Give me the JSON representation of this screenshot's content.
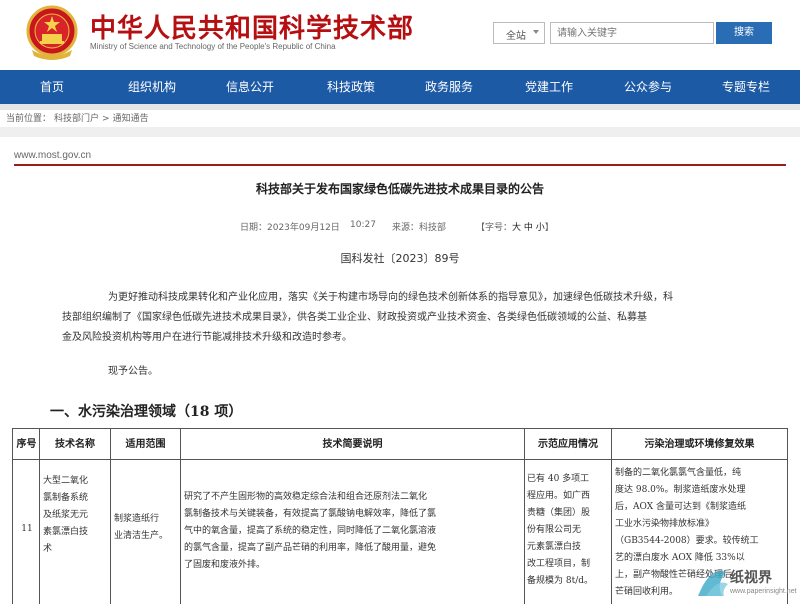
{
  "header": {
    "site_title": "中华人民共和国科学技术部",
    "site_subtitle": "Ministry of Science and Technology of the People's Republic of China",
    "search_scope": "全站",
    "search_placeholder": "请输入关键字",
    "search_button": "搜索"
  },
  "nav": [
    "首页",
    "组织机构",
    "信息公开",
    "科技政策",
    "政务服务",
    "党建工作",
    "公众参与",
    "专题专栏"
  ],
  "breadcrumb": {
    "current_label": "当前位置：",
    "items": [
      "科技部门户",
      ">",
      "通知通告"
    ]
  },
  "article": {
    "domain": "www.most.gov.cn",
    "title": "科技部关于发布国家绿色低碳先进技术成果目录的公告",
    "date": "日期：2023年09月12日",
    "time": "10:27",
    "source": "来源：科技部",
    "font_size_label": "【字号：",
    "font_size_options": "大 中 小",
    "font_size_end": "】",
    "doc_number": "国科发社〔2023〕89号",
    "paragraphs": [
      "为更好推动科技成果转化和产业化应用，落实《关于构建市场导向的绿色技术创新体系的指导意见》，加速绿色低碳技术升级，科",
      "技部组织编制了《国家绿色低碳先进技术成果目录》，供各类工业企业、财政投资或产业技术资金、各类绿色低碳领域的公益、私募基",
      "金及风险投资机构等用户在进行节能减排技术升级和改造时参考。"
    ],
    "notice": "现予公告。",
    "section": "一、水污染治理领域（18 项）"
  },
  "table": {
    "headers": [
      "序号",
      "技术名称",
      "适用范围",
      "技术简要说明",
      "示范应用情况",
      "污染治理或环境修复效果"
    ],
    "row": {
      "no": "11",
      "name": [
        "大型二氧化",
        "氯制备系统",
        "及纸浆无元",
        "素氯漂白技",
        "术"
      ],
      "scope": [
        "制浆造纸行",
        "业清洁生产。"
      ],
      "desc": [
        "研究了不产生固形物的高效稳定综合法和组合还原剂法二氧化",
        "氯制备技术与关键装备，有效提高了氯酸钠电解效率，降低了氯",
        "气中的氧含量，提高了系统的稳定性，同时降低了二氧化氯溶液",
        "的氯气含量，提高了副产品芒硝的利用率，降低了酸用量，避免",
        "了固废和废液外排。"
      ],
      "demo": [
        "已有 40 多项工",
        "程应用。如广西",
        "贵糖（集团）股",
        "份有限公司无",
        "元素氯漂白技",
        "改工程项目，制",
        "备规模为 8t/d。"
      ],
      "effect": [
        "制备的二氧化氯氯气含量低，纯",
        "度达 98.0%。制浆造纸废水处理",
        "后，AOX 含量可达到《制浆造纸",
        "工业水污染物排放标准》",
        "（GB3544-2008）要求。较传统工",
        "艺的漂白废水 AOX 降低 33%以",
        "上，副产物酸性芒硝经处理后",
        "芒硝回收利用。"
      ]
    }
  },
  "watermark": {
    "text": "纸视界",
    "url": "www.paperinsight.net"
  },
  "colors": {
    "brand_red": "#b50f12",
    "nav_blue": "#1d5aa6",
    "search_blue": "#2a6db5"
  }
}
